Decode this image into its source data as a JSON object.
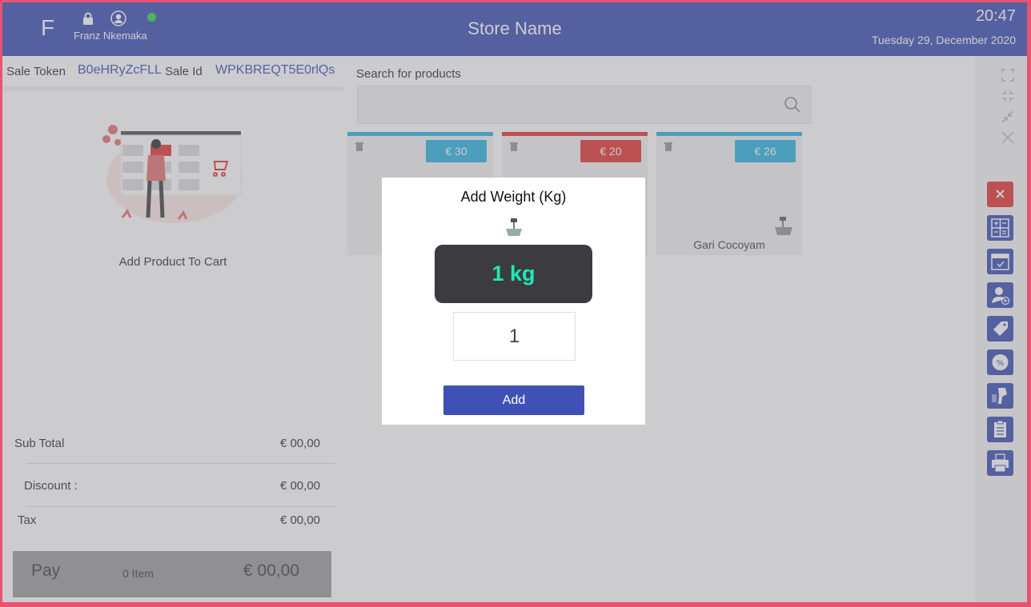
{
  "header": {
    "logo_letter": "F",
    "user_name": "Franz Nkemaka",
    "store_name": "Store Name",
    "time": "20:47",
    "date": "Tuesday 29, December  2020",
    "online_color": "#32d74b"
  },
  "sale": {
    "token_label": "Sale Token",
    "token_value": "B0eHRyZcFLL",
    "id_label": "Sale  Id",
    "id_value": "WPKBREQT5E0rlQs"
  },
  "cart": {
    "empty_text": "Add Product To Cart"
  },
  "totals": {
    "subtotal_label": "Sub Total",
    "subtotal_value": "€ 00,00",
    "discount_label": "Discount :",
    "discount_value": "€ 00,00",
    "tax_label": "Tax",
    "tax_value": "€ 00,00"
  },
  "pay": {
    "label": "Pay",
    "items": "0 Item",
    "amount": "€ 00,00"
  },
  "search": {
    "label": "Search for products",
    "placeholder": ""
  },
  "products": [
    {
      "price": "€ 30",
      "color": "#2fb5e0",
      "name": "",
      "weighted": false
    },
    {
      "price": "€ 20",
      "color": "#e53935",
      "name": "",
      "weighted": false
    },
    {
      "price": "€ 26",
      "color": "#2fb5e0",
      "name": "Gari Cocoyam",
      "weighted": true
    }
  ],
  "toolbar": {
    "tools": [
      "close-icon",
      "calculator-icon",
      "calendar-icon",
      "add-user-icon",
      "tag-icon",
      "discount-icon",
      "barcode-scanner-icon",
      "clipboard-icon",
      "printer-icon"
    ]
  },
  "modal": {
    "title": "Add Weight (Kg)",
    "weight_display": "1 kg",
    "weight_value": "1",
    "add_label": "Add"
  },
  "colors": {
    "primary": "#3f51b5",
    "danger": "#e53935",
    "accent_text": "#1de9b6",
    "frame": "#e85470"
  }
}
